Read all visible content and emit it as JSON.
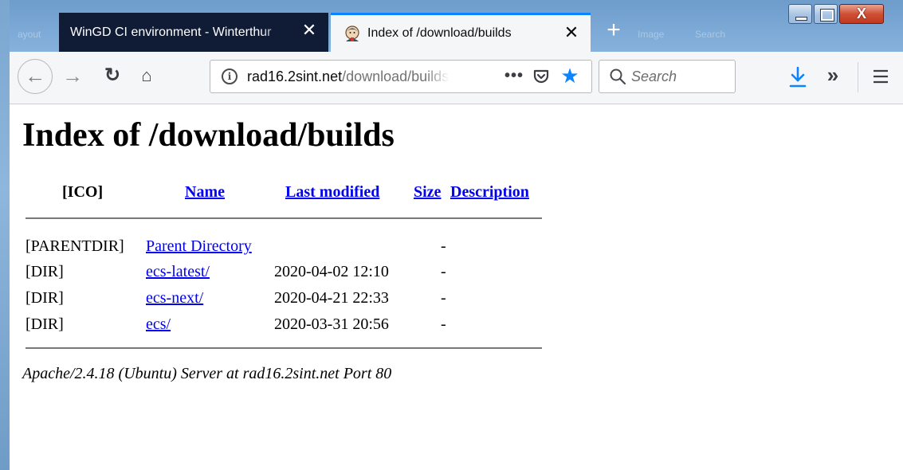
{
  "browser": {
    "tabs": [
      {
        "title": "WinGD CI environment - Winterthur",
        "close": "✕"
      },
      {
        "title": "Index of /download/builds",
        "close": "✕"
      }
    ],
    "ghost_tabs": [
      "ayout",
      "Image",
      "Search"
    ],
    "new_tab": "+",
    "window_close": "X",
    "nav": {
      "back": "←",
      "forward": "→",
      "reload": "↻",
      "home": "⌂"
    },
    "url": {
      "host": "rad16.2sint.net",
      "path": "/download/builds/"
    },
    "page_actions": "•••",
    "bookmark": "★",
    "search": {
      "placeholder": "Search"
    },
    "overflow": "»"
  },
  "page": {
    "title": "Index of /download/builds",
    "columns": {
      "icon": "[ICO]",
      "name": "Name",
      "last_modified": "Last modified",
      "size": "Size",
      "description": "Description"
    },
    "rows": [
      {
        "icon": "[PARENTDIR]",
        "name": "Parent Directory",
        "modified": "",
        "size": "-"
      },
      {
        "icon": "[DIR]",
        "name": "ecs-latest/",
        "modified": "2020-04-02 12:10",
        "size": "-"
      },
      {
        "icon": "[DIR]",
        "name": "ecs-next/",
        "modified": "2020-04-21 22:33",
        "size": "-"
      },
      {
        "icon": "[DIR]",
        "name": "ecs/",
        "modified": "2020-03-31 20:56",
        "size": "-"
      }
    ],
    "server_signature": "Apache/2.4.18 (Ubuntu) Server at rad16.2sint.net Port 80"
  },
  "colors": {
    "tab_inactive_bg": "#101b36",
    "tab_active_accent": "#0a84ff",
    "link": "#0000ee",
    "toolbar_bg": "#f5f6f7"
  }
}
